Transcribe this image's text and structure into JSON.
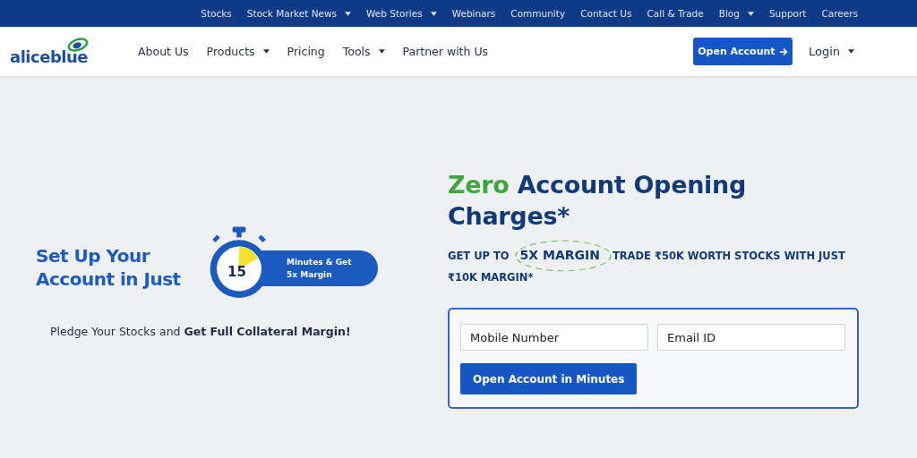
{
  "top_links": [
    {
      "label": "Stocks",
      "dropdown": false
    },
    {
      "label": "Stock Market News",
      "dropdown": true
    },
    {
      "label": "Web Stories",
      "dropdown": true
    },
    {
      "label": "Webinars",
      "dropdown": false
    },
    {
      "label": "Community",
      "dropdown": false
    },
    {
      "label": "Contact Us",
      "dropdown": false
    },
    {
      "label": "Call & Trade",
      "dropdown": false
    },
    {
      "label": "Blog",
      "dropdown": true
    },
    {
      "label": "Support",
      "dropdown": false
    },
    {
      "label": "Careers",
      "dropdown": false
    }
  ],
  "logo": {
    "text": "aliceblue"
  },
  "nav": [
    {
      "label": "About Us",
      "dropdown": false
    },
    {
      "label": "Products",
      "dropdown": true
    },
    {
      "label": "Pricing",
      "dropdown": false
    },
    {
      "label": "Tools",
      "dropdown": true
    },
    {
      "label": "Partner with Us",
      "dropdown": false
    }
  ],
  "open_account_button": "Open Account",
  "login": {
    "label": "Login",
    "dropdown": true
  },
  "promo": {
    "headline": "Set Up Your Account in Just",
    "timer": "15",
    "pill": "Minutes & Get 5x Margin",
    "pledge": "Pledge Your Stocks and **Get Full Collateral Margin!**"
  },
  "offer": {
    "highlight": "Zero",
    "title": "Account Opening Charges*",
    "lead": "GET UP TO",
    "margin": "5X MARGIN",
    "detail_lines": [
      "TRADE ₹50K WORTH STOCKS WITH JUST",
      "₹10K MARGIN*"
    ]
  },
  "form": {
    "fields": [
      {
        "placeholder": "Mobile Number"
      },
      {
        "placeholder": "Email ID"
      }
    ],
    "submit": "Open Account in Minutes"
  }
}
